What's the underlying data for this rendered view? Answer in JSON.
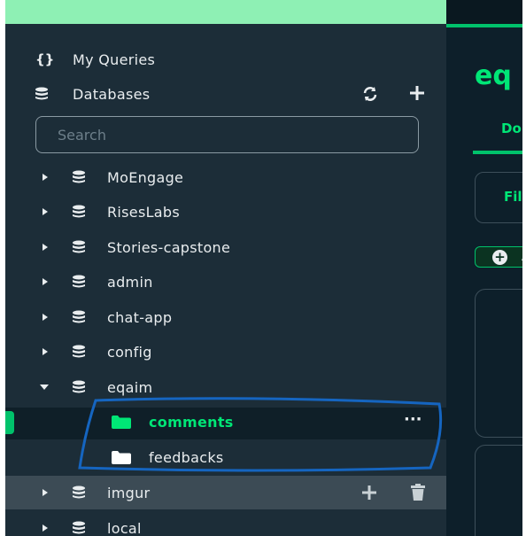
{
  "sidebar": {
    "my_queries": {
      "label": "My Queries",
      "icon": "braces-icon"
    },
    "databases": {
      "label": "Databases",
      "icon": "database-icon"
    },
    "search": {
      "placeholder": "Search",
      "value": ""
    },
    "db_items": [
      {
        "label": "MoEngage"
      },
      {
        "label": "RisesLabs"
      },
      {
        "label": "Stories-capstone"
      },
      {
        "label": "admin"
      },
      {
        "label": "chat-app"
      },
      {
        "label": "config"
      },
      {
        "label": "eqaim",
        "expanded": true
      },
      {
        "label": "imgur"
      },
      {
        "label": "local"
      }
    ],
    "collections": [
      {
        "label": "comments",
        "active": true,
        "more": "···"
      },
      {
        "label": "feedbacks"
      }
    ]
  },
  "main": {
    "title_partial": "eq",
    "tab_partial": "Do",
    "filter_partial": "Fil",
    "add_partial": "A"
  },
  "colors": {
    "accent": "#00c26b",
    "sidebar_bg": "#1c2d38",
    "annotation": "#1565c0"
  }
}
